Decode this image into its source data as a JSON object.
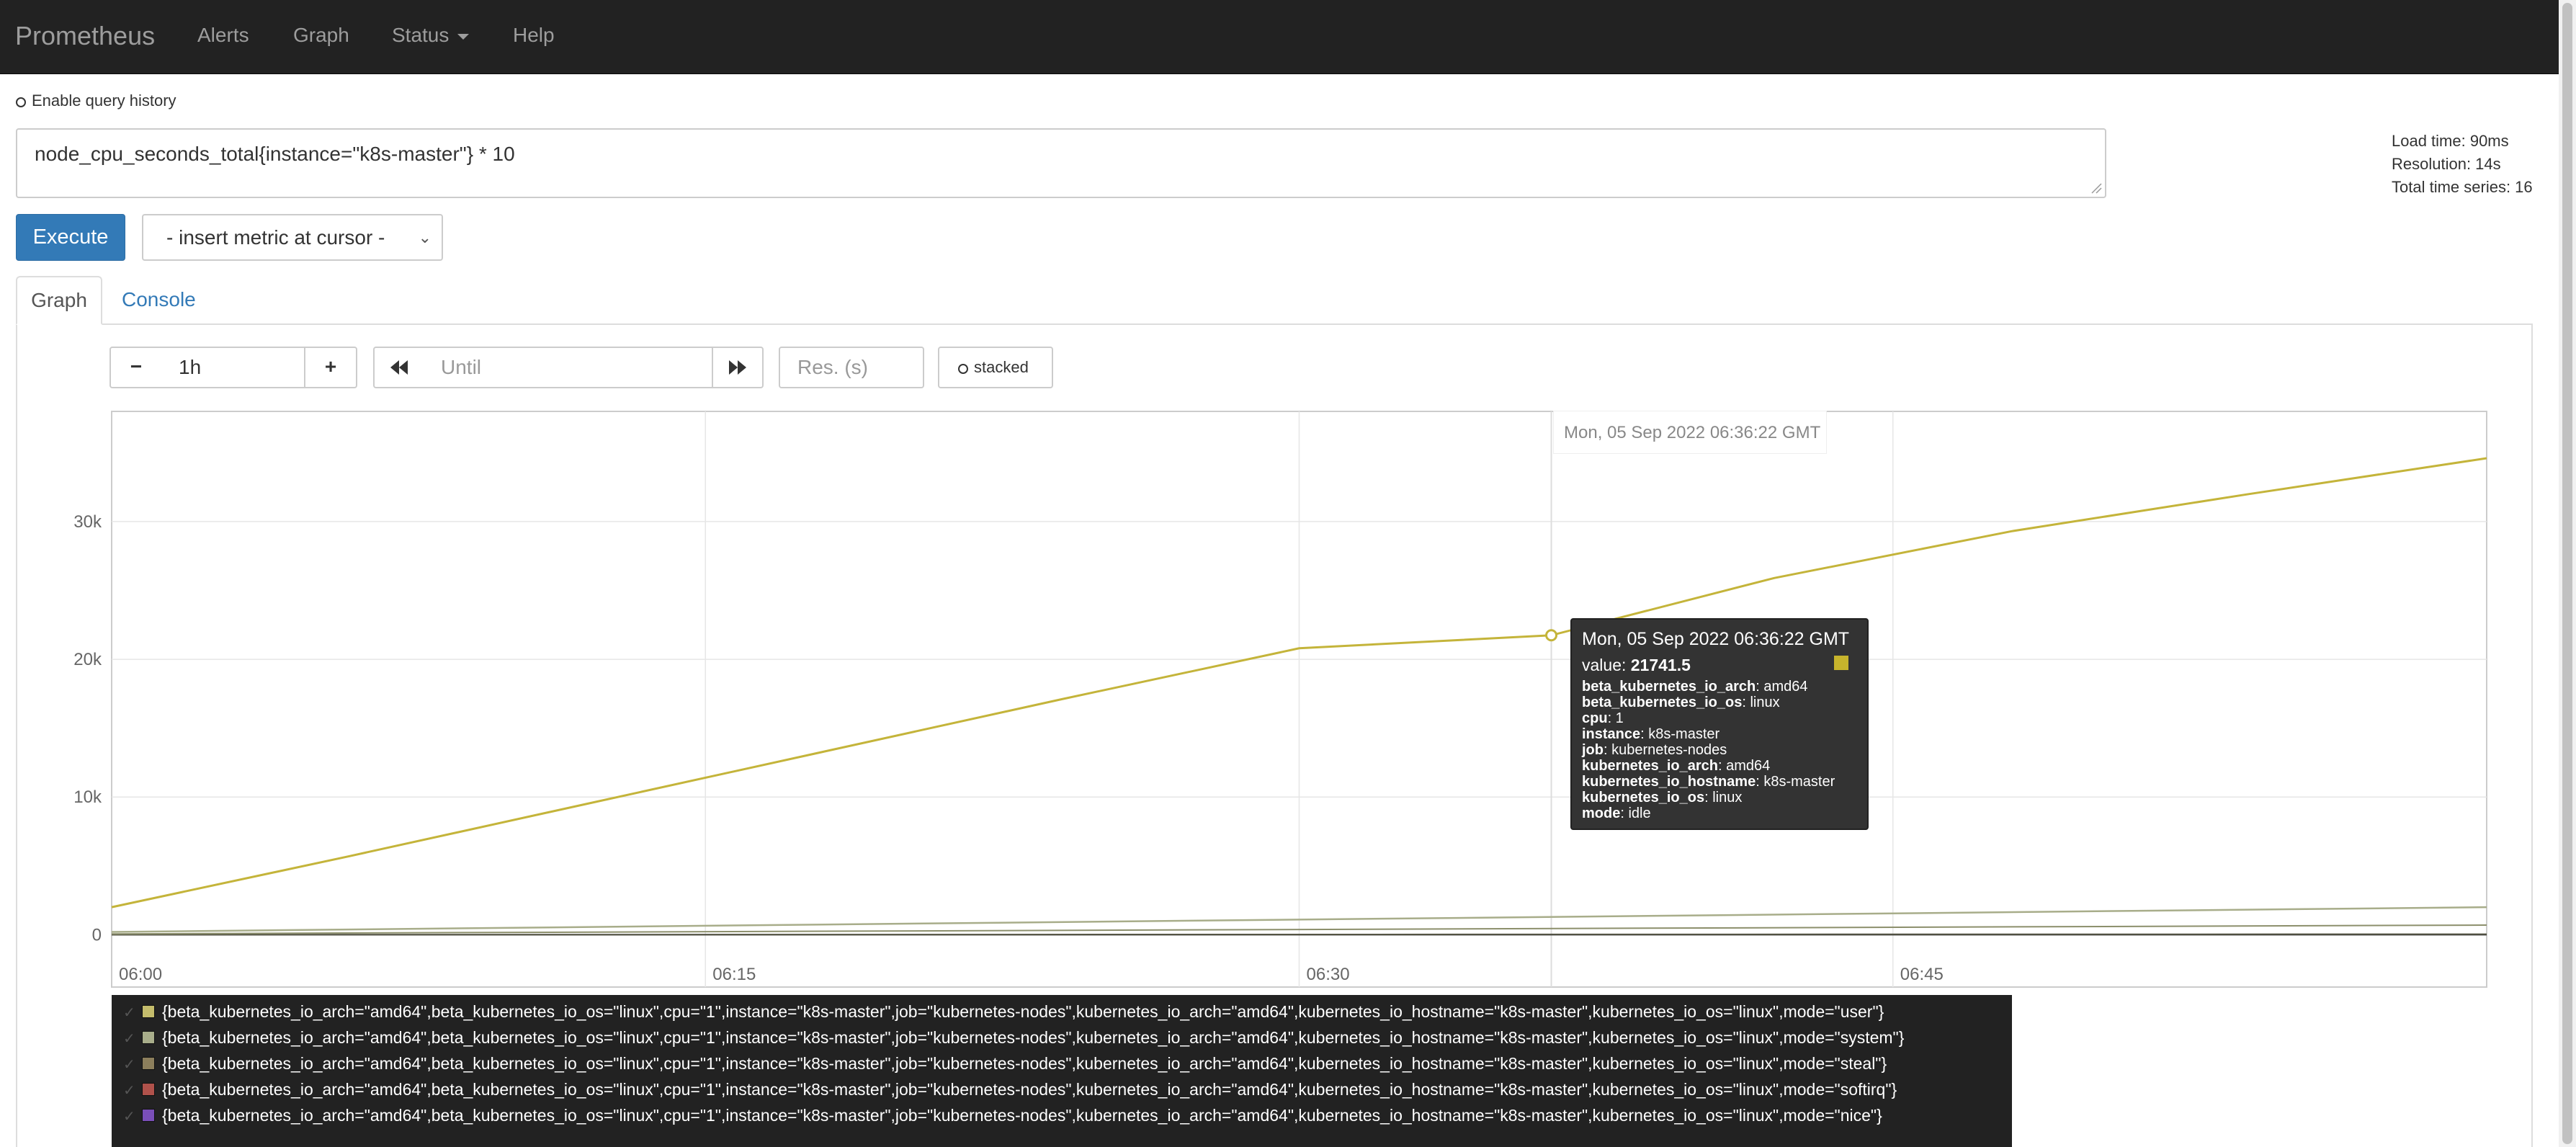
{
  "navbar": {
    "brand": "Prometheus",
    "links": [
      "Alerts",
      "Graph",
      "Status",
      "Help"
    ]
  },
  "query": {
    "history_label": "Enable query history",
    "expression": "node_cpu_seconds_total{instance=\"k8s-master\"} * 10",
    "execute_label": "Execute",
    "metric_select": "- insert metric at cursor -"
  },
  "stats": {
    "load_time": "Load time: 90ms",
    "resolution": "Resolution: 14s",
    "total_series": "Total time series: 16"
  },
  "tabs": [
    "Graph",
    "Console"
  ],
  "controls": {
    "minus": "−",
    "range": "1h",
    "plus": "+",
    "until_placeholder": "Until",
    "res_placeholder": "Res. (s)",
    "stacked_label": "stacked"
  },
  "hover_time": "Mon, 05 Sep 2022 06:36:22 GMT",
  "tooltip": {
    "date": "Mon, 05 Sep 2022 06:36:22 GMT",
    "value_label": "value:",
    "value": "21741.5",
    "labels": [
      {
        "k": "beta_kubernetes_io_arch",
        "v": "amd64"
      },
      {
        "k": "beta_kubernetes_io_os",
        "v": "linux"
      },
      {
        "k": "cpu",
        "v": "1"
      },
      {
        "k": "instance",
        "v": "k8s-master"
      },
      {
        "k": "job",
        "v": "kubernetes-nodes"
      },
      {
        "k": "kubernetes_io_arch",
        "v": "amd64"
      },
      {
        "k": "kubernetes_io_hostname",
        "v": "k8s-master"
      },
      {
        "k": "kubernetes_io_os",
        "v": "linux"
      },
      {
        "k": "mode",
        "v": "idle"
      }
    ],
    "swatch_color": "#c7b42c"
  },
  "legend": [
    {
      "text": "{beta_kubernetes_io_arch=\"amd64\",beta_kubernetes_io_os=\"linux\",cpu=\"1\",instance=\"k8s-master\",job=\"kubernetes-nodes\",kubernetes_io_arch=\"amd64\",kubernetes_io_hostname=\"k8s-master\",kubernetes_io_os=\"linux\",mode=\"user\"}",
      "color": "#c4bc6c"
    },
    {
      "text": "{beta_kubernetes_io_arch=\"amd64\",beta_kubernetes_io_os=\"linux\",cpu=\"1\",instance=\"k8s-master\",job=\"kubernetes-nodes\",kubernetes_io_arch=\"amd64\",kubernetes_io_hostname=\"k8s-master\",kubernetes_io_os=\"linux\",mode=\"system\"}",
      "color": "#a8ad8a"
    },
    {
      "text": "{beta_kubernetes_io_arch=\"amd64\",beta_kubernetes_io_os=\"linux\",cpu=\"1\",instance=\"k8s-master\",job=\"kubernetes-nodes\",kubernetes_io_arch=\"amd64\",kubernetes_io_hostname=\"k8s-master\",kubernetes_io_os=\"linux\",mode=\"steal\"}",
      "color": "#8c7f5c"
    },
    {
      "text": "{beta_kubernetes_io_arch=\"amd64\",beta_kubernetes_io_os=\"linux\",cpu=\"1\",instance=\"k8s-master\",job=\"kubernetes-nodes\",kubernetes_io_arch=\"amd64\",kubernetes_io_hostname=\"k8s-master\",kubernetes_io_os=\"linux\",mode=\"softirq\"}",
      "color": "#b0524b"
    },
    {
      "text": "{beta_kubernetes_io_arch=\"amd64\",beta_kubernetes_io_os=\"linux\",cpu=\"1\",instance=\"k8s-master\",job=\"kubernetes-nodes\",kubernetes_io_arch=\"amd64\",kubernetes_io_hostname=\"k8s-master\",kubernetes_io_os=\"linux\",mode=\"nice\"}",
      "color": "#7a4fb8"
    }
  ],
  "chart_data": {
    "type": "line",
    "x_tick_labels": [
      "06:00",
      "06:15",
      "06:30",
      "06:45"
    ],
    "y_tick_labels": [
      "0",
      "10k",
      "20k",
      "30k"
    ],
    "x_unit": "minutes since 06:00",
    "xlim": [
      0,
      60
    ],
    "ylim": [
      -3800,
      38000
    ],
    "grid": true,
    "hover_x": 36.37,
    "series": [
      {
        "color": "#c4b43a",
        "width": 3,
        "x": [
          0,
          6,
          12,
          18,
          24,
          30,
          36.37,
          42,
          48,
          54,
          60
        ],
        "y": [
          2000,
          5700,
          9500,
          13300,
          17100,
          20800,
          21741.5,
          25900,
          29300,
          32000,
          34600
        ]
      },
      {
        "color": "#a8ad8a",
        "width": 2.5,
        "x": [
          0,
          60
        ],
        "y": [
          200,
          2000
        ]
      },
      {
        "color": "#8c8f6c",
        "width": 2,
        "x": [
          0,
          60
        ],
        "y": [
          60,
          700
        ]
      },
      {
        "color": "#555544",
        "width": 2,
        "x": [
          0,
          60
        ],
        "y": [
          0,
          40
        ]
      },
      {
        "color": "#333333",
        "width": 2,
        "x": [
          0,
          60
        ],
        "y": [
          0,
          0
        ]
      }
    ],
    "highlight_point": {
      "x": 36.37,
      "y": 21741.5,
      "color": "#c4b43a"
    }
  }
}
